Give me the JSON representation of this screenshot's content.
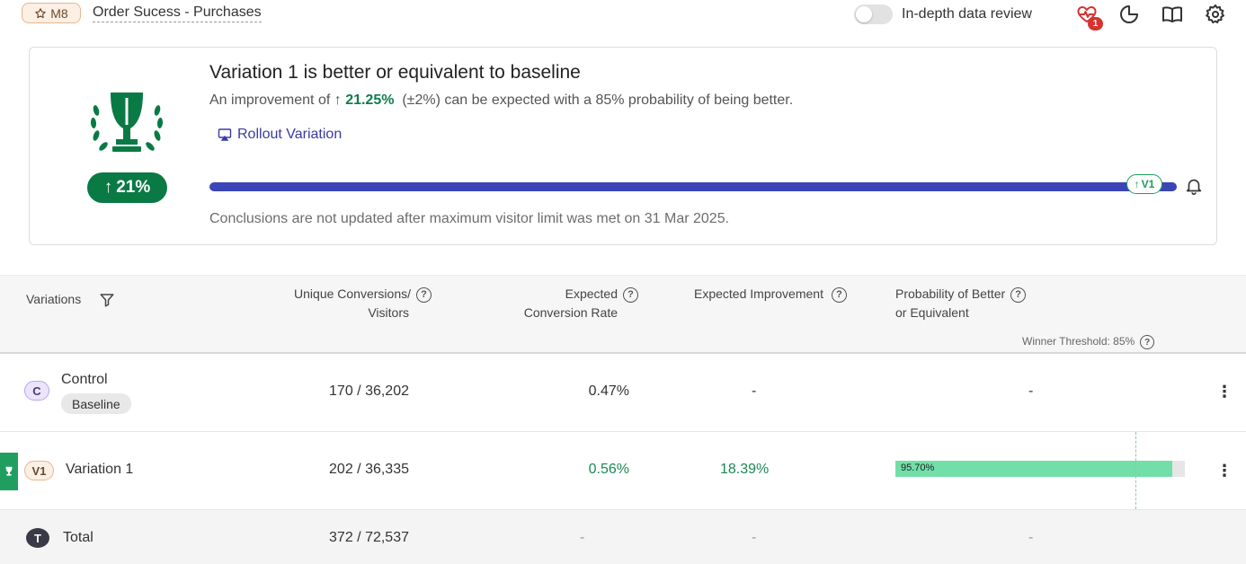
{
  "topbar": {
    "metric_badge": "M8",
    "goal_title": "Order Sucess - Purchases",
    "toggle_label": "In-depth data review",
    "toggle_on": false,
    "notification_count": "1",
    "icons": [
      "star-icon",
      "health-heart-icon",
      "pie-chart-icon",
      "book-icon",
      "gear-icon"
    ]
  },
  "summary": {
    "title": "Variation 1 is better or equivalent to baseline",
    "text_prefix": "An improvement of",
    "lift_value": "21.25%",
    "text_suffix": "(±2%) can be expected with a 85% probability of being better.",
    "rollout_label": "Rollout Variation",
    "lift_pill": "21%",
    "progress_percent": 100,
    "progress_flag": "V1",
    "note": "Conclusions are not updated after maximum visitor limit was met on 31 Mar 2025.",
    "colors": {
      "accent_green": "#0a7a45",
      "progress_blue": "#3c45b8"
    }
  },
  "table": {
    "headers": {
      "variations": "Variations",
      "conversions_line1": "Unique Conversions/",
      "conversions_line2": "Visitors",
      "rate_line1": "Expected",
      "rate_line2": "Conversion Rate",
      "improvement": "Expected Improvement",
      "probability_line1": "Probability of Better",
      "probability_line2": "or Equivalent",
      "threshold": "Winner Threshold: 85%"
    },
    "rows": [
      {
        "badge": "C",
        "name": "Control",
        "tag": "Baseline",
        "conversions": "170 / 36,202",
        "rate": "0.47%",
        "improvement": "-",
        "probability": "-"
      },
      {
        "badge": "V1",
        "name": "Variation 1",
        "tag": "",
        "conversions": "202 / 36,335",
        "rate": "0.56%",
        "improvement": "18.39%",
        "probability": "95.70%",
        "probability_value": 95.7,
        "winner": true
      }
    ],
    "total": {
      "badge": "T",
      "name": "Total",
      "conversions": "372 / 72,537",
      "rate": "-",
      "improvement": "-",
      "probability": "-"
    },
    "threshold_value": 85
  }
}
